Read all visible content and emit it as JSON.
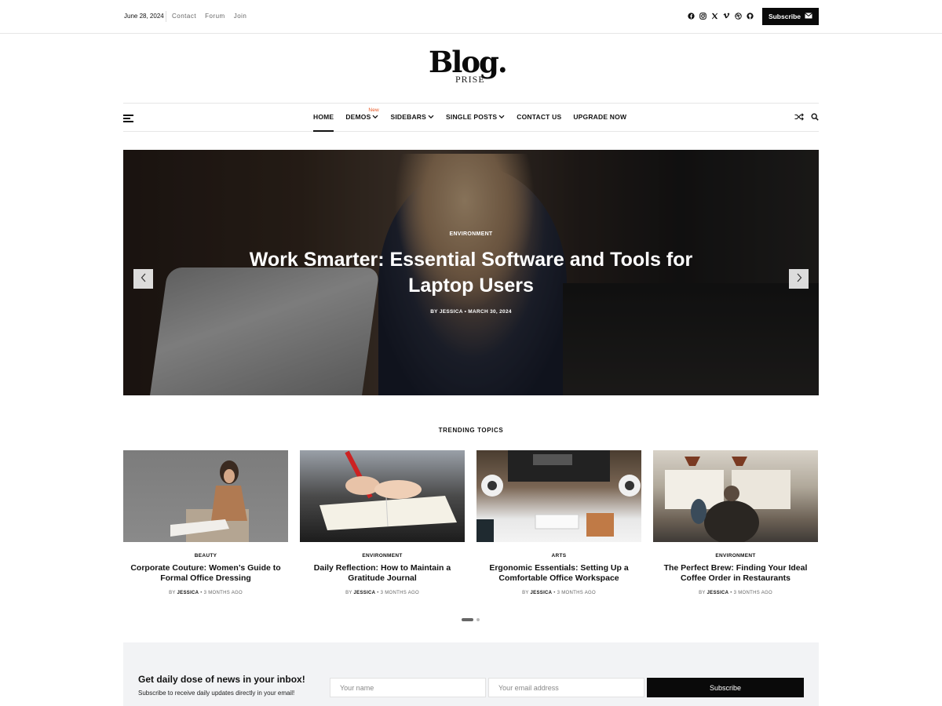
{
  "topbar": {
    "date": "June 28, 2024",
    "links": [
      "Contact",
      "Forum",
      "Join"
    ],
    "social_icons": [
      "facebook-icon",
      "instagram-icon",
      "x-icon",
      "vimeo-icon",
      "dribbble-icon",
      "github-icon"
    ],
    "subscribe_label": "Subscribe"
  },
  "logo": {
    "main": "Blog.",
    "sub": "PRISE"
  },
  "nav": {
    "items": [
      {
        "label": "HOME",
        "active": true,
        "dropdown": false
      },
      {
        "label": "DEMOS",
        "active": false,
        "dropdown": true,
        "badge": "New"
      },
      {
        "label": "SIDEBARS",
        "active": false,
        "dropdown": true
      },
      {
        "label": "SINGLE POSTS",
        "active": false,
        "dropdown": true
      },
      {
        "label": "CONTACT US",
        "active": false,
        "dropdown": false
      },
      {
        "label": "UPGRADE NOW",
        "active": false,
        "dropdown": false
      }
    ]
  },
  "hero": {
    "category": "ENVIRONMENT",
    "title_line1": "Work Smarter: Essential Software and Tools for",
    "title_line2": "Laptop Users",
    "author_prefix": "BY",
    "author": "JESSICA",
    "separator": "•",
    "date": "MARCH 30, 2024"
  },
  "trending": {
    "heading": "TRENDING TOPICS",
    "cards": [
      {
        "category": "BEAUTY",
        "title": "Corporate Couture: Women’s Guide to Formal Office Dressing",
        "by": "BY",
        "author": "JESSICA",
        "sep": "•",
        "time": "3 MONTHS AGO"
      },
      {
        "category": "ENVIRONMENT",
        "title": "Daily Reflection: How to Maintain a Gratitude Journal",
        "by": "BY",
        "author": "JESSICA",
        "sep": "•",
        "time": "3 MONTHS AGO"
      },
      {
        "category": "ARTS",
        "title": "Ergonomic Essentials: Setting Up a Comfortable Office Workspace",
        "by": "BY",
        "author": "JESSICA",
        "sep": "•",
        "time": "3 MONTHS AGO"
      },
      {
        "category": "ENVIRONMENT",
        "title": "The Perfect Brew: Finding Your Ideal Coffee Order in Restaurants",
        "by": "BY",
        "author": "JESSICA",
        "sep": "•",
        "time": "3 MONTHS AGO"
      }
    ]
  },
  "newsletter": {
    "heading": "Get daily dose of news in your inbox!",
    "subheading": "Subscribe to receive daily updates directly in your email!",
    "name_placeholder": "Your name",
    "email_placeholder": "Your email address",
    "button_label": "Subscribe"
  },
  "colors": {
    "accent": "#0a0a0a",
    "badge": "#e8531d",
    "newsletter_bg": "#f2f3f5"
  }
}
